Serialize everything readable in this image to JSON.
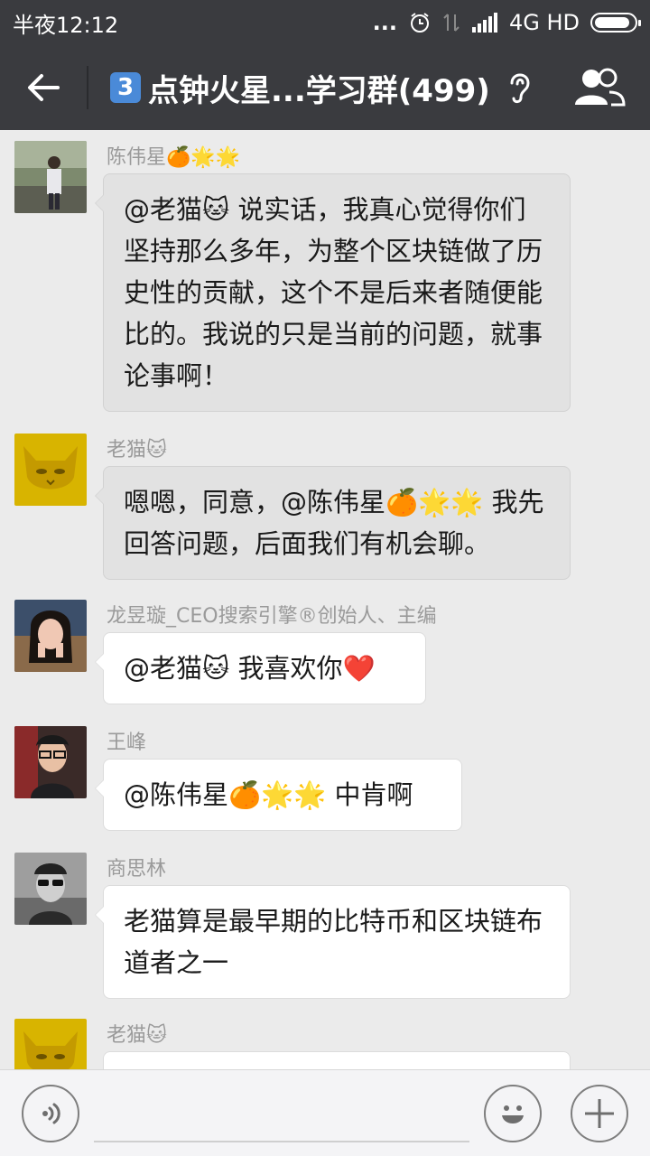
{
  "status_bar": {
    "time": "半夜12:12",
    "dots": "...",
    "network": "4G HD",
    "icons": [
      "alarm-icon",
      "data-arrows-icon",
      "signal-icon",
      "battery-icon"
    ],
    "battery_level": 0.9
  },
  "header": {
    "number_badge": "3",
    "title": "点钟火星...学习群(499)",
    "icons": [
      "back-arrow-icon",
      "ear-icon",
      "group-members-icon"
    ]
  },
  "messages": [
    {
      "sender": "陈伟星🍊🌟🌟",
      "text": "@老猫🐱 说实话，我真心觉得你们坚持那么多年，为整个区块链做了历史性的贡献，这个不是后来者随便能比的。我说的只是当前的问题，就事论事啊！"
    },
    {
      "sender": "老猫🐱",
      "text": "嗯嗯，同意，@陈伟星🍊🌟🌟 我先回答问题，后面我们有机会聊。"
    },
    {
      "sender": "龙昱璇_CEO搜索引擎®创始人、主编",
      "text": "@老猫🐱 我喜欢你❤️"
    },
    {
      "sender": "王峰",
      "text": "@陈伟星🍊🌟🌟 中肯啊"
    },
    {
      "sender": "商思林",
      "text": "老猫算是最早期的比特币和区块链布道者之一"
    },
    {
      "sender": "老猫🐱",
      "text": ""
    }
  ],
  "input_bar": {
    "placeholder": "",
    "icons": [
      "voice-icon",
      "emoji-icon",
      "plus-icon"
    ]
  },
  "colors": {
    "header_bg": "#3a3b3f",
    "chat_bg": "#ebebeb",
    "bubble_grey": "#e2e2e2",
    "bubble_white": "#ffffff",
    "sender_text": "#9a9a9a",
    "laomao_avatar": "#d8b400"
  }
}
